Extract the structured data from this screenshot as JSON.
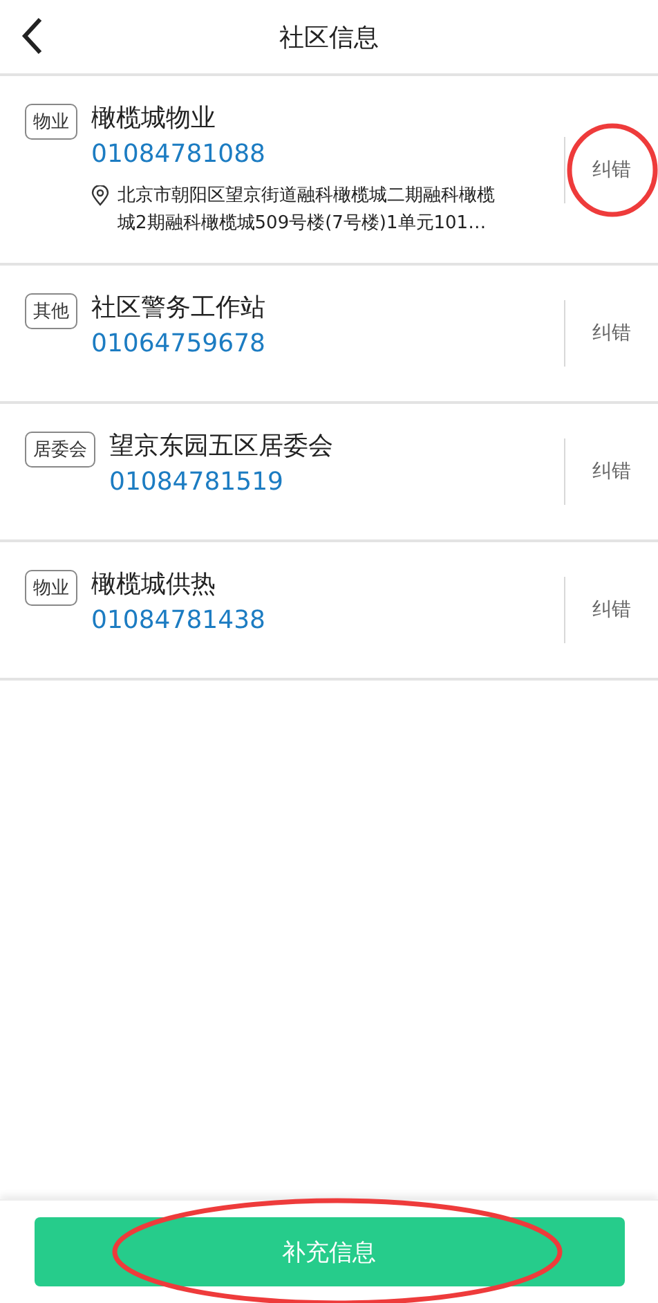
{
  "header": {
    "title": "社区信息"
  },
  "entries": [
    {
      "tag": "物业",
      "name": "橄榄城物业",
      "phone": "01084781088",
      "address": "北京市朝阳区望京街道融科橄榄城二期融科橄榄城2期融科橄榄城509号楼(7号楼)1单元101…",
      "action": "纠错",
      "circled": true
    },
    {
      "tag": "其他",
      "name": "社区警务工作站",
      "phone": "01064759678",
      "action": "纠错",
      "circled": false
    },
    {
      "tag": "居委会",
      "name": "望京东园五区居委会",
      "phone": "01084781519",
      "action": "纠错",
      "circled": false
    },
    {
      "tag": "物业",
      "name": "橄榄城供热",
      "phone": "01084781438",
      "action": "纠错",
      "circled": false
    }
  ],
  "footer": {
    "button": "补充信息",
    "circled": true
  }
}
